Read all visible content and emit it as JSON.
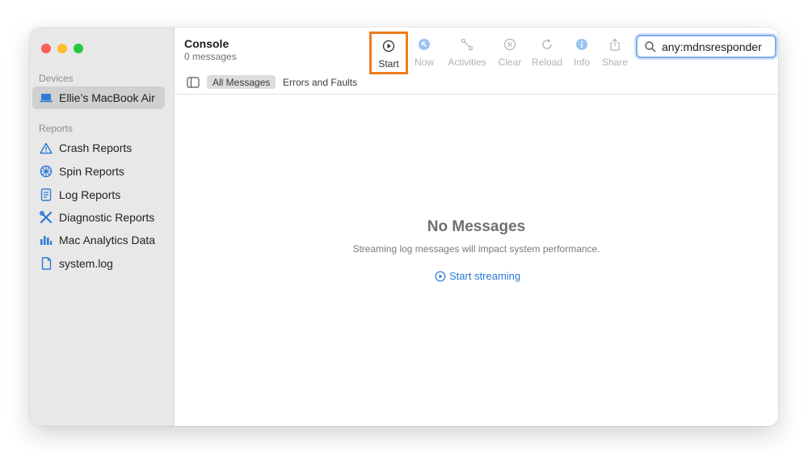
{
  "app": {
    "title": "Console",
    "subtitle": "0 messages"
  },
  "sidebar": {
    "devices_label": "Devices",
    "device": {
      "label": "Ellie’s MacBook Air",
      "icon": "laptop-icon"
    },
    "reports_label": "Reports",
    "items": [
      {
        "label": "Crash Reports",
        "icon": "warning-triangle-icon"
      },
      {
        "label": "Spin Reports",
        "icon": "spin-wheel-icon"
      },
      {
        "label": "Log Reports",
        "icon": "document-list-icon"
      },
      {
        "label": "Diagnostic Reports",
        "icon": "wrench-screwdriver-icon"
      },
      {
        "label": "Mac Analytics Data",
        "icon": "bar-chart-icon"
      },
      {
        "label": "system.log",
        "icon": "document-icon"
      }
    ]
  },
  "toolbar": {
    "start": "Start",
    "now": "Now",
    "activities": "Activities",
    "clear": "Clear",
    "reload": "Reload",
    "info": "Info",
    "share": "Share"
  },
  "search": {
    "value": "any:mdnsresponder"
  },
  "filters": {
    "all": "All Messages",
    "errors": "Errors and Faults"
  },
  "empty": {
    "title": "No Messages",
    "subtitle": "Streaming log messages will impact system performance.",
    "link": "Start streaming"
  },
  "colors": {
    "accent": "#2a77d6",
    "highlight_box": "#f07d1d",
    "search_focus": "#80aef0"
  }
}
